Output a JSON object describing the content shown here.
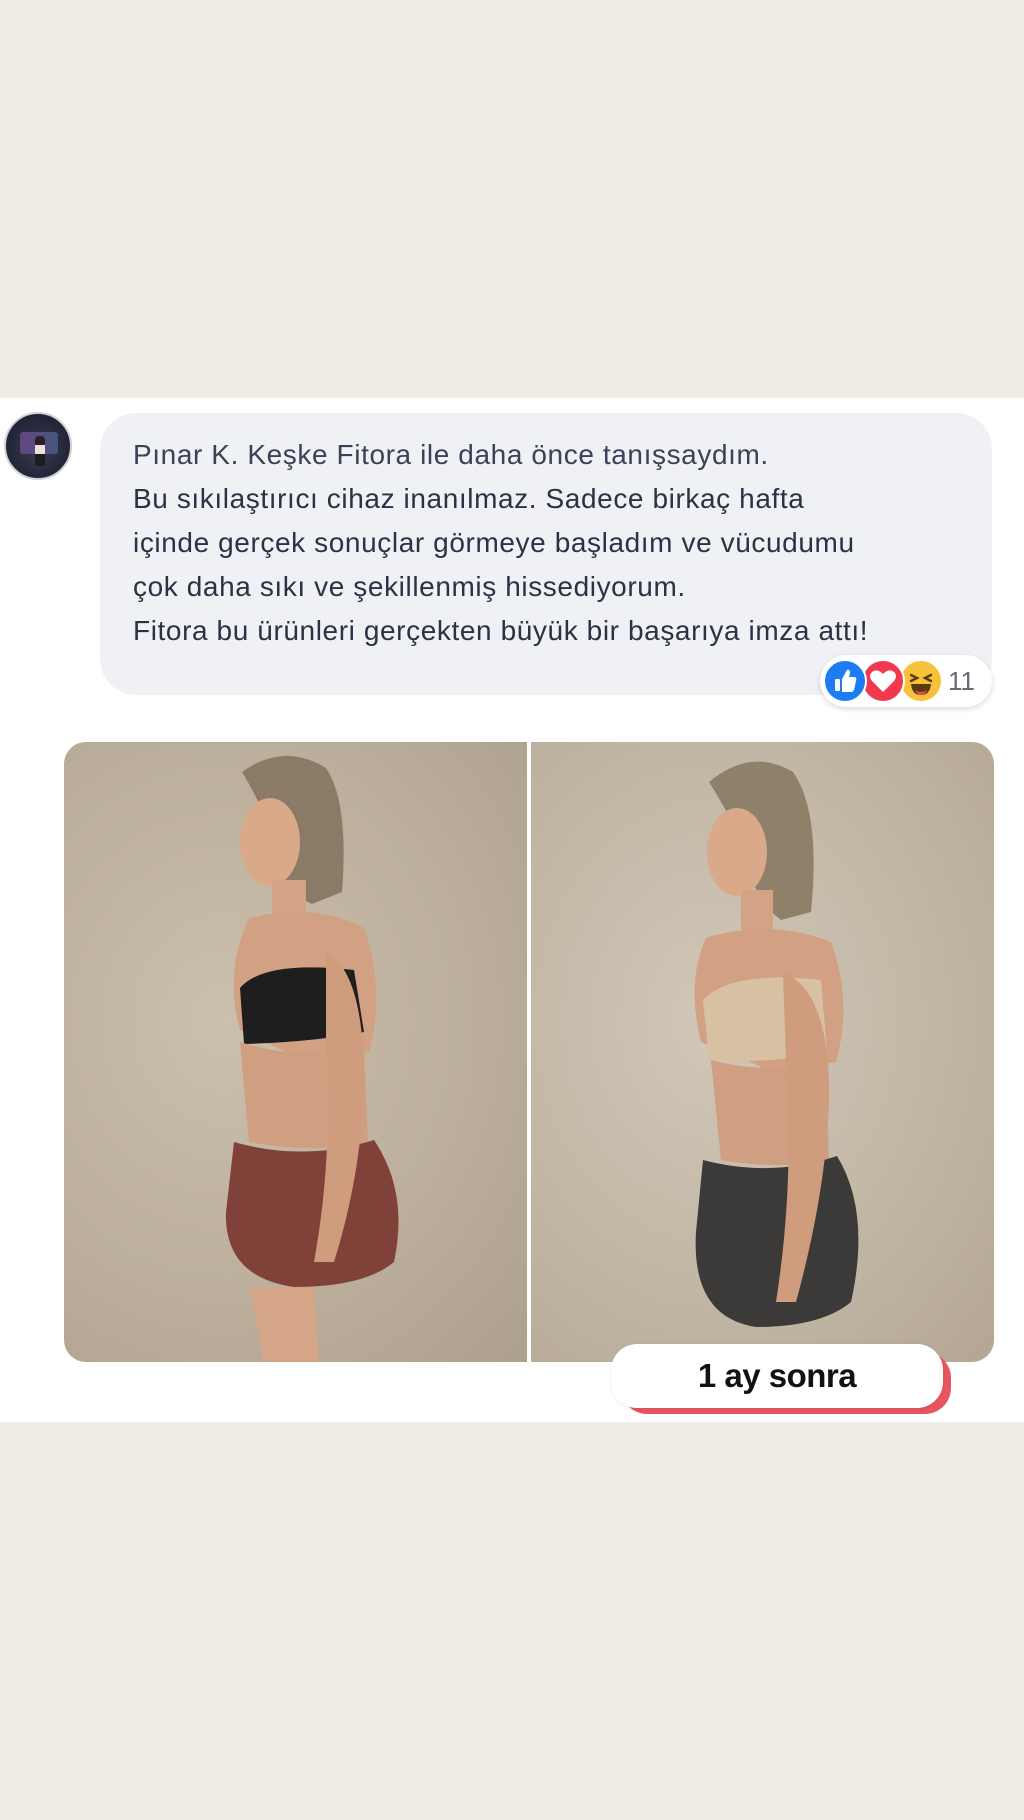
{
  "comment": {
    "author": "Pınar K.",
    "lines": [
      "Keşke Fitora ile daha önce tanışsaydım.",
      "Bu sıkılaştırıcı cihaz inanılmaz. Sadece birkaç hafta",
      "içinde gerçek sonuçlar görmeye başladım ve vücudumu",
      "çok daha sıkı ve şekillenmiş hissediyorum.",
      "Fitora bu ürünleri gerçekten büyük bir başarıya imza attı!"
    ]
  },
  "reactions": {
    "icons": [
      "like-icon",
      "love-icon",
      "haha-icon"
    ],
    "count": "11",
    "colors": {
      "like": "#1c7cf4",
      "love": "#f0384f",
      "haha": "#f7c23a"
    }
  },
  "photos": {
    "caption": "1 ay sonra",
    "caption_accent": "#e85560"
  }
}
